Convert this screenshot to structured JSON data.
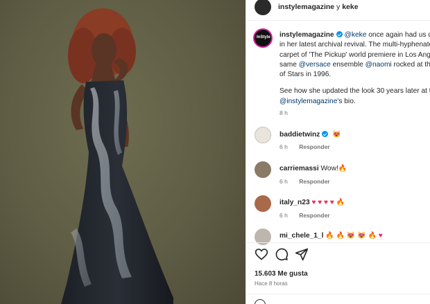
{
  "post": {
    "author": "instylemagazine",
    "separator": "y",
    "collaborator": "keke",
    "caption": {
      "username": "instylemagazine",
      "mention_keke": "@keke",
      "line1_rest": " once again had us do",
      "line2": "in her latest archival revival. The multi-hyphenate",
      "line3": "carpet of 'The Pickup' world premiere in Los Ang",
      "line4_a": "same ",
      "mention_versace": "@versace",
      "line4_b": " ensemble ",
      "mention_naomi": "@naomi",
      "line4_c": " rocked at the",
      "line5": "of Stars in 1996.",
      "line6": "See how she updated the look 30 years later at t",
      "mention_instyle": "@instylemagazine",
      "line7_rest": "'s bio.",
      "time": "8 h"
    },
    "avatar_label": "InStyle"
  },
  "comments": [
    {
      "user": "baddietwinz",
      "verified": true,
      "text": "",
      "emojis": [
        "😻"
      ],
      "time": "6 h",
      "reply": "Responder"
    },
    {
      "user": "carriemassi",
      "verified": false,
      "text": "Wow!",
      "emojis": [
        "🔥"
      ],
      "time": "6 h",
      "reply": "Responder"
    },
    {
      "user": "italy_n23",
      "verified": false,
      "text": "",
      "emojis": [
        "♥",
        "♥",
        "♥",
        "♥",
        "🔥"
      ],
      "time": "6 h",
      "reply": "Responder"
    },
    {
      "user": "mi_chele_1_l",
      "verified": false,
      "text": "",
      "emojis": [
        "🔥",
        "🔥",
        "😻",
        "😻",
        "🔥",
        "♥"
      ],
      "time": "",
      "reply": ""
    }
  ],
  "footer": {
    "likes": "15.603 Me gusta",
    "ago": "Hace 8 horas"
  },
  "icons": {
    "like": "heart-icon",
    "comment": "comment-icon",
    "share": "share-icon"
  },
  "colors": {
    "link": "#00376b",
    "verified": "#0095f6",
    "muted": "#737373",
    "heart": "#ed2a55"
  }
}
